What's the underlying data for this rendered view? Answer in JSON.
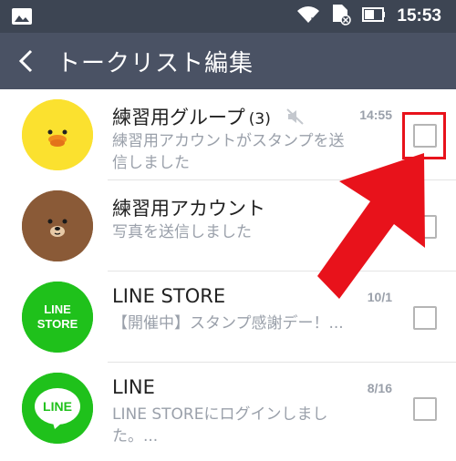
{
  "status_bar": {
    "time": "15:53",
    "icons": [
      "image-icon",
      "wifi-icon",
      "sim-icon",
      "battery-icon"
    ]
  },
  "header": {
    "title": "トークリスト編集",
    "back_icon": "back-arrow-icon"
  },
  "chats": [
    {
      "name": "練習用グループ",
      "count": "(3)",
      "muted": true,
      "message": "練習用アカウントがスタンプを送信しました",
      "time": "14:55",
      "avatar": "yellow-chick",
      "checked": false
    },
    {
      "name": "練習用アカウント",
      "message": "写真を送信しました",
      "time": "",
      "avatar": "brown-bear",
      "checked": false
    },
    {
      "name": "LINE STORE",
      "message": "【開催中】スタンプ感謝デー！...",
      "time": "10/1",
      "avatar": "line-store-logo",
      "avatar_text": "LINE STORE",
      "checked": false
    },
    {
      "name": "LINE",
      "message": "LINE STOREにログインしました。...",
      "time": "8/16",
      "avatar": "line-logo",
      "avatar_text": "LINE",
      "checked": false
    }
  ],
  "annotation": {
    "color": "#e8121b",
    "target": "checkbox"
  },
  "colors": {
    "statusbar": "#3d4553",
    "header": "#4a5264",
    "line_green": "#1fc11b",
    "muted_text": "#9aa0aa"
  }
}
